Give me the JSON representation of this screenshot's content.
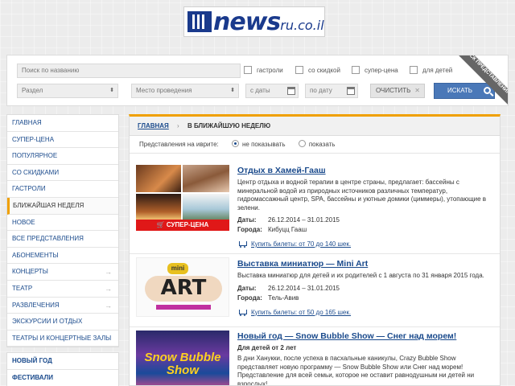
{
  "logo": {
    "news": "news",
    "domain": "ru.co.il"
  },
  "search": {
    "name_placeholder": "Поиск по названию",
    "section": "Раздел",
    "venue": "Место проведения",
    "date_from": "с даты",
    "date_to": "по дату",
    "checkboxes": [
      "гастроли",
      "со скидкой",
      "супер-цена",
      "для детей"
    ],
    "clear_label": "ОЧИСТИТЬ",
    "search_label": "ИСКАТЬ",
    "ribbon": "ПОИСК ПРЕДСТАВЛЕНИЯ"
  },
  "sidebar": {
    "items": [
      "ГЛАВНАЯ",
      "СУПЕР-ЦЕНА",
      "ПОПУЛЯРНОЕ",
      "СО СКИДКАМИ",
      "ГАСТРОЛИ",
      "БЛИЖАЙШАЯ НЕДЕЛЯ",
      "НОВОЕ",
      "ВСЕ ПРЕДСТАВЛЕНИЯ",
      "АБОНЕМЕНТЫ",
      "КОНЦЕРТЫ",
      "ТЕАТР",
      "РАЗВЛЕЧЕНИЯ",
      "ЭКСКУРСИИ И ОТДЫХ",
      "ТЕАТРЫ И КОНЦЕРТНЫЕ ЗАЛЫ"
    ],
    "extra": [
      "НОВЫЙ ГОД",
      "ФЕСТИВАЛИ"
    ]
  },
  "breadcrumb": {
    "home": "ГЛАВНАЯ",
    "sep": "›",
    "current": "В БЛИЖАЙШУЮ НЕДЕЛЮ"
  },
  "hebrew": {
    "label": "Представления на иврите:",
    "opt1": "не показывать",
    "opt2": "показать"
  },
  "labels": {
    "dates": "Даты:",
    "city": "Города:"
  },
  "events": [
    {
      "title": "Отдых в Хамей-Гааш",
      "desc": "Центр отдыха и водной терапии в центре страны, предлагает: бассейны с минеральной водой из природных источников различных температур, гидромассажный центр, SPA, бассейны и уютные домики (циммеры), утопающие в зелени.",
      "dates": "26.12.2014 – 31.01.2015",
      "city": "Кибуцц Гааш",
      "buy": "Купить билеты: от 70 до 140 шек.",
      "badge": "СУПЕР-ЦЕНА"
    },
    {
      "title": "Выставка миниатюр — Mini Art",
      "desc": "Выставка миниатюр для детей и их родителей с 1 августа по 31 января 2015 года.",
      "dates": "26.12.2014 – 31.01.2015",
      "city": "Тель-Авив",
      "buy": "Купить билеты: от 50 до 165 шек.",
      "img_mini": "mini",
      "img_art": "ART"
    },
    {
      "title": "Новый год — Snow Bubble Show — Снег над морем!",
      "sub": "Для детей от 2 лет",
      "desc": "В дни Ханукки, после успеха в пасхальные каникулы, Crazy Bubble Show представляет новую программу — Snow Bubble Show или Снег над морем! Представление для всей семьи, которое не оставит равнодушным ни детей ни взрослых!",
      "img_text": "Snow Bubble Show"
    }
  ],
  "colors": {
    "accent": "#f0a000",
    "link": "#1a4a8c",
    "super": "#e01818",
    "search_btn": "#4a78b8"
  }
}
